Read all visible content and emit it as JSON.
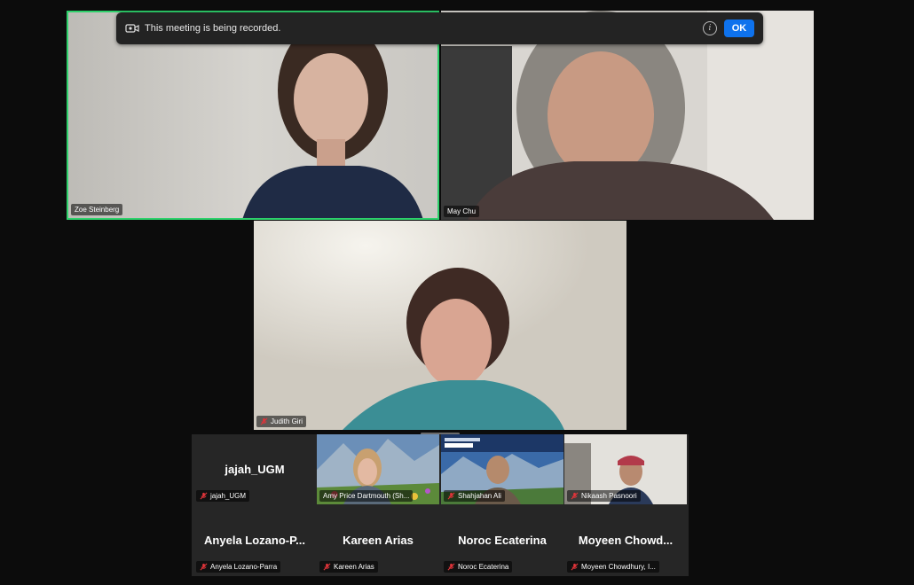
{
  "banner": {
    "message": "This meeting is being recorded.",
    "ok_label": "OK",
    "info_label": "i"
  },
  "speakers": [
    {
      "name": "Zoe Steinberg",
      "active": true
    },
    {
      "name": "May Chu"
    },
    {
      "name": "Judith Giri",
      "muted": true
    }
  ],
  "gallery": [
    {
      "display": "jajah_UGM",
      "label": "jajah_UGM"
    },
    {
      "label": "Amy Price Dartmouth (Sh..."
    },
    {
      "label": "Shahjahan Ali"
    },
    {
      "label": "Nikaash Pasnoori"
    },
    {
      "display": "Anyela  Lozano-P...",
      "label": "Anyela Lozano-Parra"
    },
    {
      "display": "Kareen Arias",
      "label": "Kareen Arias"
    },
    {
      "display": "Noroc Ecaterina",
      "label": "Noroc Ecaterina"
    },
    {
      "display": "Moyeen  Chowd...",
      "label": "Moyeen Chowdhury, I..."
    }
  ],
  "colors": {
    "active_border": "#2ed16b",
    "accent": "#0e72ed",
    "muted_icon": "#e0343a"
  }
}
